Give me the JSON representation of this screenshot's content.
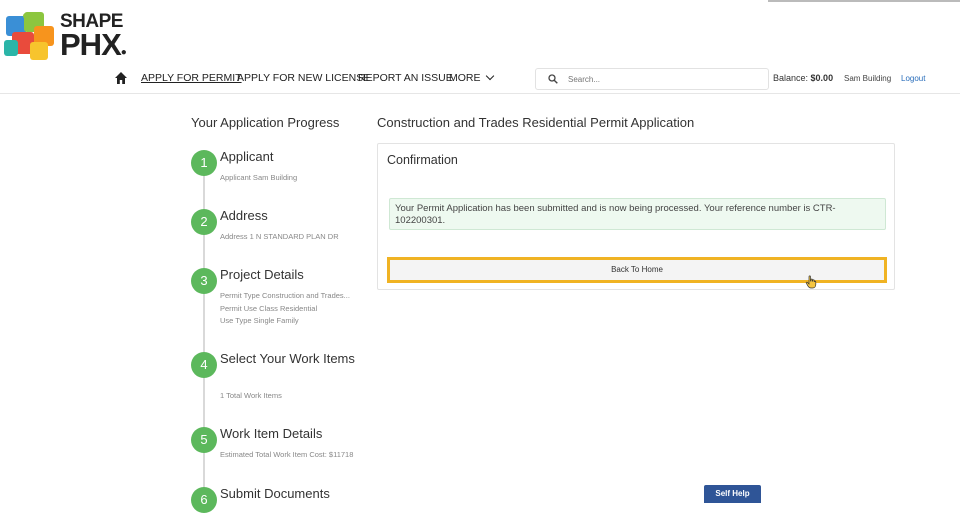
{
  "brand": {
    "line1": "SHAPE",
    "line2": "PHX"
  },
  "nav": {
    "items": [
      {
        "label": "APPLY FOR PERMIT",
        "active": true
      },
      {
        "label": "APPLY FOR NEW LICENSE"
      },
      {
        "label": "REPORT AN ISSUE"
      },
      {
        "label": "MORE"
      }
    ],
    "search_placeholder": "Search...",
    "balance_label": "Balance:",
    "balance_value": "$0.00",
    "user": "Sam Building",
    "logout": "Logout"
  },
  "progress": {
    "title": "Your Application Progress",
    "steps": [
      {
        "number": "1",
        "title": "Applicant",
        "details": [
          "Applicant  Sam Building"
        ]
      },
      {
        "number": "2",
        "title": "Address",
        "details": [
          "Address  1 N STANDARD PLAN DR"
        ]
      },
      {
        "number": "3",
        "title": "Project Details",
        "details": [
          "Permit Type  Construction and Trades...",
          "Permit Use Class  Residential",
          "Use Type  Single Family"
        ]
      },
      {
        "number": "4",
        "title": "Select Your Work Items",
        "details": [
          "1 Total Work Items"
        ]
      },
      {
        "number": "5",
        "title": "Work Item Details",
        "details": [
          "Estimated Total Work Item Cost: $11718"
        ]
      },
      {
        "number": "6",
        "title": "Submit Documents",
        "details": []
      }
    ]
  },
  "main": {
    "title": "Construction and Trades Residential Permit Application",
    "card_title": "Confirmation",
    "message": "Your Permit Application has been submitted and is now being processed. Your reference number is CTR-102200301.",
    "button": "Back To Home"
  },
  "self_help": "Self Help",
  "colors": {
    "step_green": "#5cb85c",
    "highlight": "#f0b323",
    "self_help": "#2f5597",
    "link": "#2a6ebb"
  }
}
